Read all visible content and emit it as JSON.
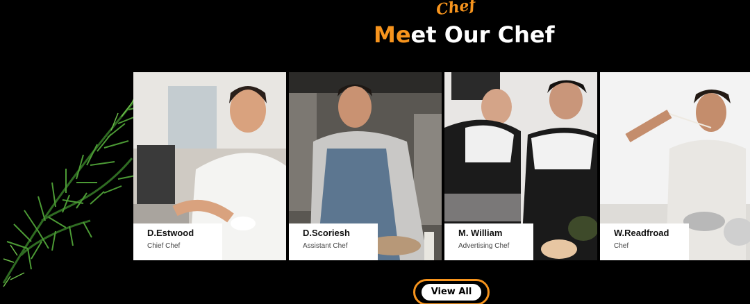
{
  "header": {
    "script_label": "Chef",
    "title_accent": "Me",
    "title_rest": "et Our Chef"
  },
  "chefs": [
    {
      "name": "D.Estwood",
      "role": "Chief Chef"
    },
    {
      "name": "D.Scoriesh",
      "role": "Assistant Chef"
    },
    {
      "name": "M. William",
      "role": "Advertising Chef"
    },
    {
      "name": "W.Readfroad",
      "role": "Chef"
    }
  ],
  "cta": {
    "label": "View All"
  },
  "colors": {
    "accent": "#f7941d",
    "background": "#000000"
  }
}
